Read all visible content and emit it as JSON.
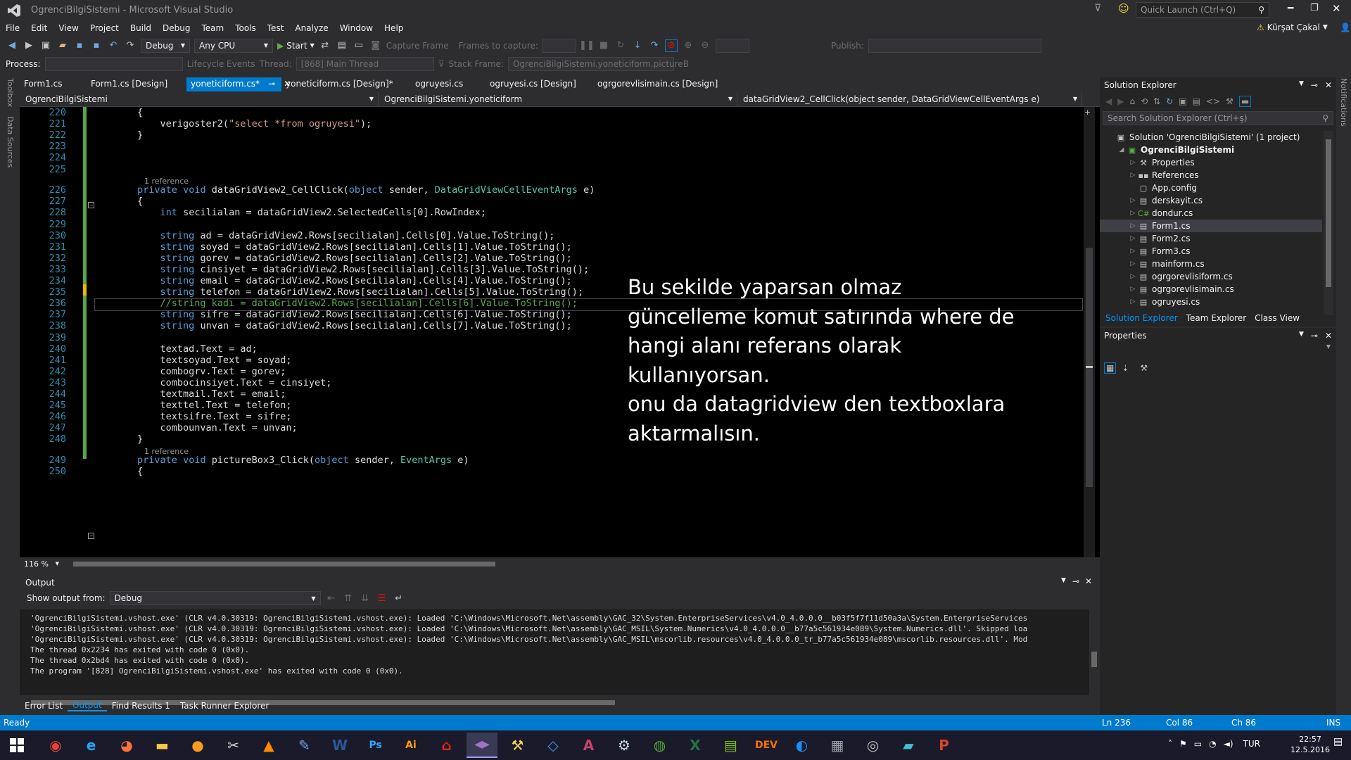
{
  "window": {
    "title": "OgrenciBilgiSistemi - Microsoft Visual Studio",
    "quick_launch": "Quick Launch (Ctrl+Q)",
    "user": "Kürşat Çakal"
  },
  "menu": [
    "File",
    "Edit",
    "View",
    "Project",
    "Build",
    "Debug",
    "Team",
    "Tools",
    "Test",
    "Analyze",
    "Window",
    "Help"
  ],
  "toolbar": {
    "config": "Debug",
    "platform": "Any CPU",
    "start": "Start",
    "capture_frame": "Capture Frame",
    "frames_label": "Frames to capture:",
    "publish_label": "Publish:"
  },
  "debugbar": {
    "process_label": "Process:",
    "lifecycle": "Lifecycle Events",
    "thread_label": "Thread:",
    "thread_value": "[868] Main Thread",
    "stackframe_label": "Stack Frame:",
    "stackframe_value": "OgrenciBilgiSistemi.yoneticiform.pictureB"
  },
  "side": {
    "toolbox": "Toolbox",
    "data_sources": "Data Sources",
    "notifications": "Notifications"
  },
  "tabs": [
    {
      "label": "Form1.cs",
      "active": false
    },
    {
      "label": "Form1.cs [Design]",
      "active": false
    },
    {
      "label": "yoneticiform.cs*",
      "active": true
    },
    {
      "label": "yoneticiform.cs [Design]*",
      "active": false
    },
    {
      "label": "ogruyesi.cs",
      "active": false
    },
    {
      "label": "ogruyesi.cs [Design]",
      "active": false
    },
    {
      "label": "ogrgorevlisimain.cs [Design]",
      "active": false
    }
  ],
  "nav": {
    "project": "OgrenciBilgiSistemi",
    "class": "OgrenciBilgiSistemi.yoneticiform",
    "member": "dataGridView2_CellClick(object sender, DataGridViewCellEventArgs e)"
  },
  "code": {
    "line_numbers": [
      "220",
      "221",
      "222",
      "223",
      "224",
      "225",
      "226",
      "227",
      "228",
      "229",
      "230",
      "231",
      "232",
      "233",
      "234",
      "235",
      "236",
      "237",
      "238",
      "239",
      "240",
      "241",
      "242",
      "243",
      "244",
      "245",
      "246",
      "247",
      "248",
      "249",
      "250"
    ],
    "lines": [
      {
        "t": "        {"
      },
      {
        "t": "            verigoster2(\"select *from ogruyesi\");"
      },
      {
        "t": "        }"
      },
      {
        "t": ""
      },
      {
        "t": ""
      },
      {
        "t": ""
      },
      {
        "ref": "1 reference",
        "t": "        private void dataGridView2_CellClick(object sender, DataGridViewCellEventArgs e)"
      },
      {
        "t": "        {"
      },
      {
        "t": "            int secilialan = dataGridView2.SelectedCells[0].RowIndex;"
      },
      {
        "t": ""
      },
      {
        "t": "            string ad = dataGridView2.Rows[secilialan].Cells[0].Value.ToString();"
      },
      {
        "t": "            string soyad = dataGridView2.Rows[secilialan].Cells[1].Value.ToString();"
      },
      {
        "t": "            string gorev = dataGridView2.Rows[secilialan].Cells[2].Value.ToString();"
      },
      {
        "t": "            string cinsiyet = dataGridView2.Rows[secilialan].Cells[3].Value.ToString();"
      },
      {
        "t": "            string email = dataGridView2.Rows[secilialan].Cells[4].Value.ToString();"
      },
      {
        "t": "            string telefon = dataGridView2.Rows[secilialan].Cells[5].Value.ToString();"
      },
      {
        "t": "            //string kadı = dataGridView2.Rows[secilialan].Cells[6].Value.ToString();"
      },
      {
        "t": "            string sifre = dataGridView2.Rows[secilialan].Cells[6].Value.ToString();"
      },
      {
        "t": "            string unvan = dataGridView2.Rows[secilialan].Cells[7].Value.ToString();"
      },
      {
        "t": ""
      },
      {
        "t": "            textad.Text = ad;"
      },
      {
        "t": "            textsoyad.Text = soyad;"
      },
      {
        "t": "            combogrv.Text = gorev;"
      },
      {
        "t": "            combocinsiyet.Text = cinsiyet;"
      },
      {
        "t": "            textmail.Text = email;"
      },
      {
        "t": "            texttel.Text = telefon;"
      },
      {
        "t": "            textsifre.Text = sifre;"
      },
      {
        "t": "            combounvan.Text = unvan;"
      },
      {
        "t": "        }"
      },
      {
        "ref": "1 reference",
        "t": "        private void pictureBox3_Click(object sender, EventArgs e)"
      },
      {
        "t": "        {"
      }
    ]
  },
  "overlay_text": [
    "Bu sekilde yaparsan olmaz",
    "güncelleme komut satırında where de",
    "hangi alanı referans olarak",
    "kullanıyorsan.",
    "onu da datagridview den textboxlara",
    "aktarmalısın."
  ],
  "zoom": "116 %",
  "output": {
    "title": "Output",
    "show_from_label": "Show output from:",
    "show_from_value": "Debug",
    "lines": [
      "'OgrenciBilgiSistemi.vshost.exe' (CLR v4.0.30319: OgrenciBilgiSistemi.vshost.exe): Loaded 'C:\\Windows\\Microsoft.Net\\assembly\\GAC_32\\System.EnterpriseServices\\v4.0_4.0.0.0__b03f5f7f11d50a3a\\System.EnterpriseServices",
      "'OgrenciBilgiSistemi.vshost.exe' (CLR v4.0.30319: OgrenciBilgiSistemi.vshost.exe): Loaded 'C:\\Windows\\Microsoft.Net\\assembly\\GAC_MSIL\\System.Numerics\\v4.0_4.0.0.0__b77a5c561934e089\\System.Numerics.dll'. Skipped loa",
      "'OgrenciBilgiSistemi.vshost.exe' (CLR v4.0.30319: OgrenciBilgiSistemi.vshost.exe): Loaded 'C:\\Windows\\Microsoft.Net\\assembly\\GAC_MSIL\\mscorlib.resources\\v4.0_4.0.0.0_tr_b77a5c561934e089\\mscorlib.resources.dll'. Mod",
      "The thread 0x2234 has exited with code 0 (0x0).",
      "The thread 0x2bd4 has exited with code 0 (0x0).",
      "The program '[828] OgrenciBilgiSistemi.vshost.exe' has exited with code 0 (0x0)."
    ]
  },
  "bottom_tabs": [
    {
      "label": "Error List",
      "active": false
    },
    {
      "label": "Output",
      "active": true
    },
    {
      "label": "Find Results 1",
      "active": false
    },
    {
      "label": "Task Runner Explorer",
      "active": false
    }
  ],
  "solution_explorer": {
    "title": "Solution Explorer",
    "search_placeholder": "Search Solution Explorer (Ctrl+ş)",
    "items": [
      {
        "label": "Solution 'OgrenciBilgiSistemi' (1 project)",
        "level": 0,
        "icon": "solution-icon",
        "expander": ""
      },
      {
        "label": "OgrenciBilgiSistemi",
        "level": 1,
        "icon": "csharp-project-icon",
        "expander": "expanded",
        "bold": true
      },
      {
        "label": "Properties",
        "level": 2,
        "icon": "wrench-icon",
        "expander": "collapsed"
      },
      {
        "label": "References",
        "level": 2,
        "icon": "references-icon",
        "expander": "collapsed"
      },
      {
        "label": "App.config",
        "level": 2,
        "icon": "config-file-icon",
        "expander": ""
      },
      {
        "label": "derskayit.cs",
        "level": 2,
        "icon": "form-icon",
        "expander": "collapsed"
      },
      {
        "label": "dondur.cs",
        "level": 2,
        "icon": "cs-class-icon",
        "expander": "collapsed"
      },
      {
        "label": "Form1.cs",
        "level": 2,
        "icon": "form-icon",
        "expander": "collapsed",
        "selected": true
      },
      {
        "label": "Form2.cs",
        "level": 2,
        "icon": "form-icon",
        "expander": "collapsed"
      },
      {
        "label": "Form3.cs",
        "level": 2,
        "icon": "form-icon",
        "expander": "collapsed"
      },
      {
        "label": "mainform.cs",
        "level": 2,
        "icon": "form-icon",
        "expander": "collapsed"
      },
      {
        "label": "ogrgorevlisiform.cs",
        "level": 2,
        "icon": "form-icon",
        "expander": "collapsed"
      },
      {
        "label": "ogrgorevlisimain.cs",
        "level": 2,
        "icon": "form-icon",
        "expander": "collapsed"
      },
      {
        "label": "ogruyesi.cs",
        "level": 2,
        "icon": "form-icon",
        "expander": "collapsed"
      }
    ],
    "tabs": [
      {
        "label": "Solution Explorer",
        "active": true
      },
      {
        "label": "Team Explorer",
        "active": false
      },
      {
        "label": "Class View",
        "active": false
      }
    ]
  },
  "properties": {
    "title": "Properties"
  },
  "status": {
    "ready": "Ready",
    "ln": "Ln 236",
    "col": "Col 86",
    "ch": "Ch 86",
    "ins": "INS"
  },
  "taskbar": {
    "apps": [
      {
        "name": "chrome-icon",
        "glyph": "◉",
        "color": "#e94235"
      },
      {
        "name": "internet-explorer-icon",
        "glyph": "e",
        "color": "#1ea7ff"
      },
      {
        "name": "firefox-icon",
        "glyph": "◕",
        "color": "#ff7139"
      },
      {
        "name": "file-explorer-icon",
        "glyph": "▬",
        "color": "#f8c74a"
      },
      {
        "name": "photo-app-icon",
        "glyph": "●",
        "color": "#ff9a1f"
      },
      {
        "name": "tools-icon",
        "glyph": "✂",
        "color": "#d0d0d0"
      },
      {
        "name": "vlc-icon",
        "glyph": "▲",
        "color": "#ff8800"
      },
      {
        "name": "paint-icon",
        "glyph": "✎",
        "color": "#6fa8dc"
      },
      {
        "name": "word-icon",
        "glyph": "W",
        "color": "#2b5797"
      },
      {
        "name": "photoshop-icon",
        "glyph": "Ps",
        "color": "#31a8ff"
      },
      {
        "name": "illustrator-icon",
        "glyph": "Ai",
        "color": "#ff9a00"
      },
      {
        "name": "acrobat-icon",
        "glyph": "⌂",
        "color": "#e0221b"
      },
      {
        "name": "visual-studio-icon",
        "glyph": "◀▶",
        "color": "#a074c4"
      },
      {
        "name": "wrench-icon",
        "glyph": "⚒",
        "color": "#f2d15a"
      },
      {
        "name": "vscode-icon",
        "glyph": "◇",
        "color": "#3c99dc"
      },
      {
        "name": "access-icon",
        "glyph": "A",
        "color": "#c6426e"
      },
      {
        "name": "steam-icon",
        "glyph": "⚙",
        "color": "#c7d5e0"
      },
      {
        "name": "globe-icon",
        "glyph": "◍",
        "color": "#4fa83d"
      },
      {
        "name": "excel-icon",
        "glyph": "X",
        "color": "#217346"
      },
      {
        "name": "notepad-icon",
        "glyph": "▤",
        "color": "#7fba00"
      },
      {
        "name": "devexpress-icon",
        "glyph": "DEV",
        "color": "#ff7200"
      },
      {
        "name": "media-player-icon",
        "glyph": "◐",
        "color": "#1d8ef5"
      },
      {
        "name": "calculator-icon",
        "glyph": "▦",
        "color": "#9aa0a6"
      },
      {
        "name": "disc-icon",
        "glyph": "◎",
        "color": "#c0c0c0"
      },
      {
        "name": "edit-icon",
        "glyph": "▰",
        "color": "#3ec1d3"
      },
      {
        "name": "powerpoint-icon",
        "glyph": "P",
        "color": "#d24726"
      }
    ],
    "lang": "TUR",
    "time": "22:57",
    "date": "12.5.2016"
  }
}
